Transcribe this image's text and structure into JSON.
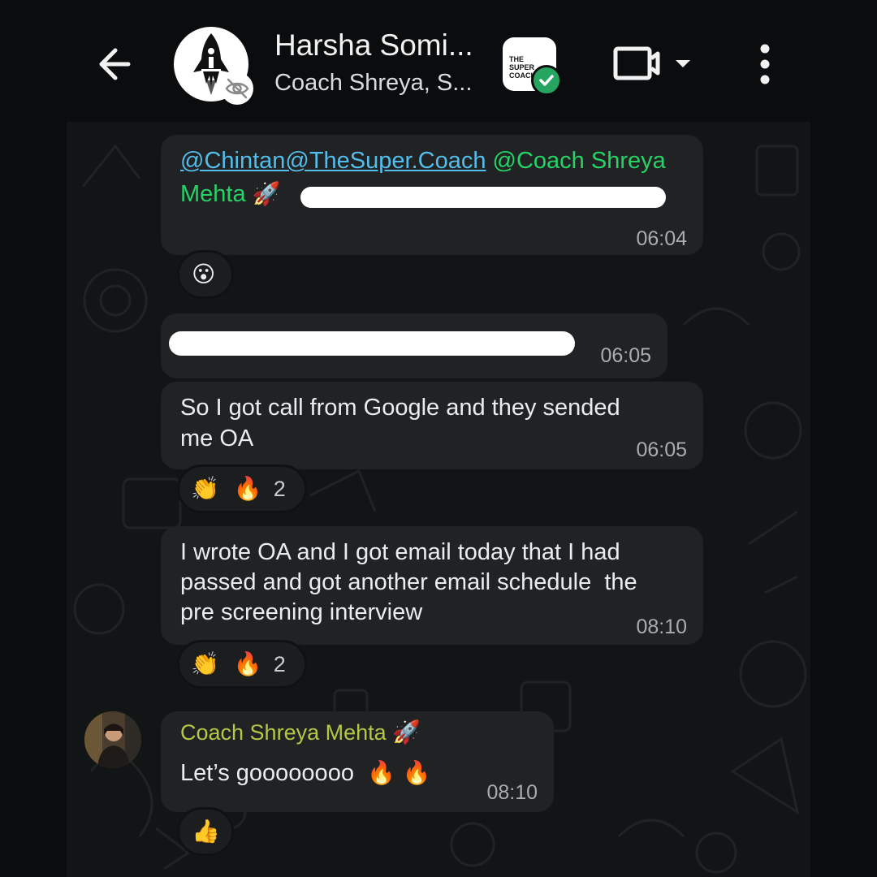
{
  "header": {
    "title": "Harsha Somi...",
    "subtitle": "Coach Shreya, S...",
    "community_logo_text": "THE SUPER COACH"
  },
  "messages": [
    {
      "mention_1": "@Chintan@TheSuper.Coach",
      "mention_2": "@Coach Shreya",
      "mention_2b": "Mehta",
      "mention_emoji": "🚀",
      "time": "06:04",
      "reaction": "😮"
    },
    {
      "time": "06:05"
    },
    {
      "line1": "So I got call from Google and they sended",
      "line2": "me OA",
      "time": "06:05",
      "reaction_emojis": [
        "👏",
        "🔥"
      ],
      "reaction_count": "2"
    },
    {
      "line1": "I wrote OA and I got email today that I had",
      "line2": "passed and got another email schedule  the",
      "line3": "pre screening interview",
      "time": "08:10",
      "reaction_emojis": [
        "👏",
        "🔥"
      ],
      "reaction_count": "2"
    },
    {
      "sender": "Coach Shreya Mehta",
      "sender_emoji": "🚀",
      "text": "Let’s goooooooo",
      "text_emojis": "🔥 🔥",
      "time": "08:10",
      "reaction": "👍"
    }
  ],
  "icons": [
    "back-arrow-icon",
    "avatar-rocket-icon",
    "eye-off-icon",
    "verified-check-icon",
    "video-camera-icon",
    "chevron-down-icon",
    "more-vertical-icon"
  ],
  "colors": {
    "background": "#0b0c0d",
    "bubble": "#202223",
    "mention_blue": "#53bdeb",
    "mention_green": "#25d366",
    "sender_name": "#b6c745",
    "verified": "#25a55f"
  }
}
